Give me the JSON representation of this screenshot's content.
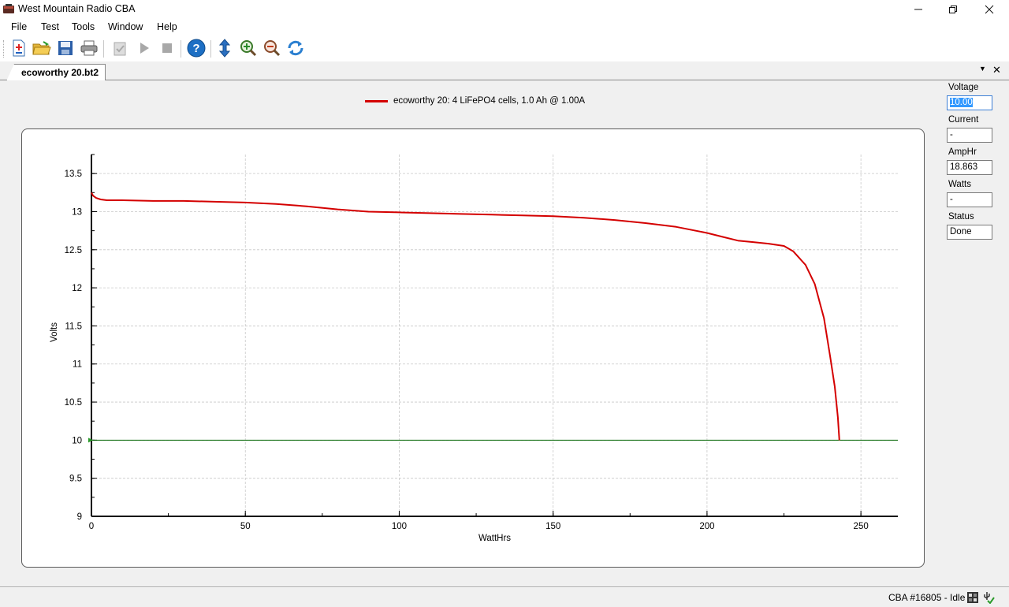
{
  "window": {
    "title": "West Mountain Radio CBA",
    "app_icon": "battery-analyzer-icon",
    "controls": {
      "minimize": "minimize-icon",
      "maximize": "restore-icon",
      "close": "close-icon"
    }
  },
  "menu": [
    "File",
    "Test",
    "Tools",
    "Window",
    "Help"
  ],
  "toolbar": {
    "buttons": [
      {
        "name": "new-test-icon"
      },
      {
        "name": "open-folder-icon"
      },
      {
        "name": "save-icon"
      },
      {
        "name": "print-icon"
      },
      {
        "name": "checklist-icon"
      },
      {
        "name": "play-icon"
      },
      {
        "name": "stop-icon"
      },
      {
        "name": "help-icon"
      },
      {
        "name": "vertical-scale-icon"
      },
      {
        "name": "zoom-in-icon"
      },
      {
        "name": "zoom-out-icon"
      },
      {
        "name": "refresh-icon"
      }
    ]
  },
  "tab": {
    "label": "ecoworthy 20.bt2"
  },
  "legend": {
    "label": "ecoworthy 20: 4 LiFePO4 cells, 1.0 Ah @ 1.00A",
    "color": "#d40000"
  },
  "side_panel": {
    "voltage": {
      "label": "Voltage",
      "value": "10.00"
    },
    "current": {
      "label": "Current",
      "value": "-"
    },
    "amphr": {
      "label": "AmpHr",
      "value": "18.863"
    },
    "watts": {
      "label": "Watts",
      "value": "-"
    },
    "status": {
      "label": "Status",
      "value": "Done"
    }
  },
  "status_bar": {
    "text": "CBA #16805 - Idle"
  },
  "chart_data": {
    "type": "line",
    "xlabel": "WattHrs",
    "ylabel": "Volts",
    "xlim": [
      0,
      262
    ],
    "ylim": [
      9,
      13.75
    ],
    "x_ticks": [
      0,
      50,
      100,
      150,
      200,
      250
    ],
    "y_ticks": [
      9,
      9.5,
      10,
      10.5,
      11,
      11.5,
      12,
      12.5,
      13,
      13.5
    ],
    "grid": true,
    "legend_position": "top-center",
    "cutoff_line": {
      "y": 10,
      "color": "#006400"
    },
    "series": [
      {
        "name": "ecoworthy 20: 4 LiFePO4 cells, 1.0 Ah @ 1.00A",
        "color": "#d40000",
        "x": [
          0,
          0.5,
          1.5,
          3,
          5,
          10,
          20,
          30,
          40,
          50,
          60,
          70,
          80,
          90,
          100,
          110,
          120,
          130,
          140,
          150,
          160,
          170,
          180,
          190,
          200,
          205,
          210,
          215,
          220,
          225,
          228,
          232,
          235,
          238,
          240,
          241.5,
          242.5,
          243
        ],
        "y": [
          13.25,
          13.21,
          13.18,
          13.16,
          13.15,
          13.15,
          13.14,
          13.14,
          13.13,
          13.12,
          13.1,
          13.07,
          13.03,
          13.0,
          12.99,
          12.98,
          12.97,
          12.96,
          12.95,
          12.94,
          12.92,
          12.89,
          12.85,
          12.8,
          12.72,
          12.67,
          12.62,
          12.6,
          12.58,
          12.55,
          12.48,
          12.3,
          12.05,
          11.6,
          11.1,
          10.7,
          10.3,
          10.0
        ]
      }
    ]
  }
}
